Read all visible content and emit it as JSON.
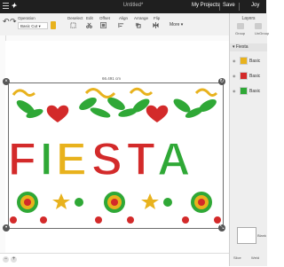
{
  "app": {
    "title": "Untitled*",
    "my_projects": "My Projects",
    "save": "Save",
    "user": "Joy"
  },
  "toolbar": {
    "operation_label": "Operation",
    "operation_value": "Basic Cut",
    "deselect": "Deselect",
    "edit": "Edit",
    "offset": "Offset",
    "align": "Align",
    "arrange": "Arrange",
    "flip": "Flip",
    "more": "More"
  },
  "canvas": {
    "width_readout": "66.491 cm"
  },
  "design": {
    "word": "FIESTA",
    "letter_colors": [
      "#d32a2a",
      "#2fa836",
      "#e8b21d",
      "#d32a2a",
      "#d32a2a",
      "#2fa836"
    ]
  },
  "layers_panel": {
    "title": "Layers",
    "tabs": [
      "Group",
      "UnGroup"
    ],
    "group_label": "Fiesta",
    "items": [
      {
        "label": "Basic",
        "color": "#e8b21d"
      },
      {
        "label": "Basic",
        "color": "#d32a2a"
      },
      {
        "label": "Basic",
        "color": "#2fa836"
      }
    ],
    "blank_canvas": "Blank",
    "bottom": [
      "Slice",
      "Weld"
    ]
  },
  "colors": {
    "red": "#d32a2a",
    "green": "#2fa836",
    "yellow": "#e8b21d",
    "topbar": "#1f1f1f"
  },
  "icons": [
    "menu-icon",
    "undo-icon",
    "redo-icon",
    "lock-icon",
    "rotate-icon",
    "resize-icon",
    "zoom-out-icon",
    "zoom-in-icon",
    "eye-icon"
  ]
}
